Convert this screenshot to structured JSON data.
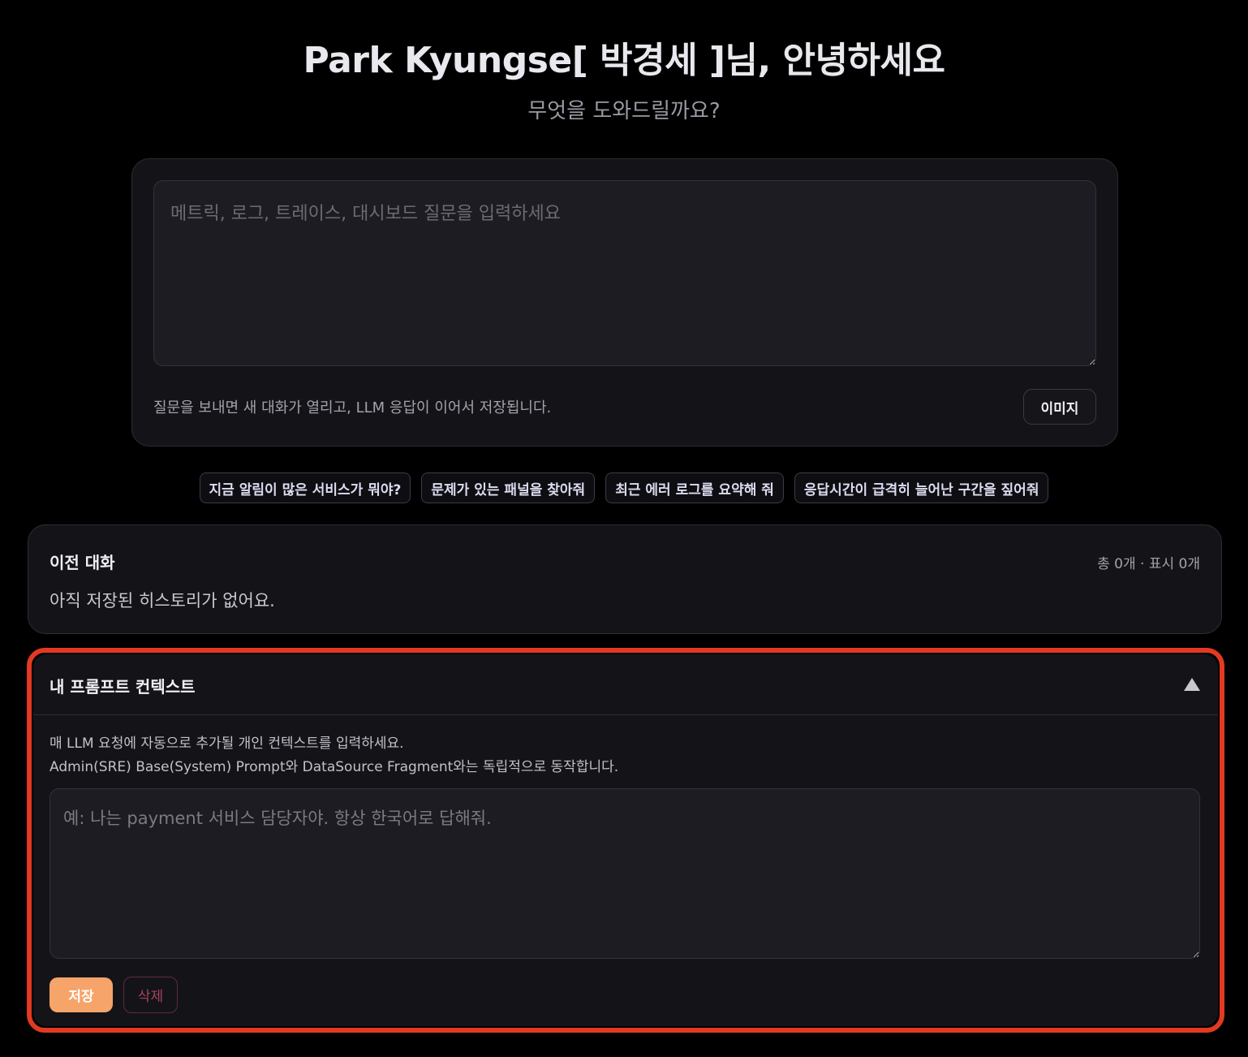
{
  "header": {
    "greeting": "Park Kyungse[ 박경세 ]님, 안녕하세요",
    "subtitle": "무엇을 도와드릴까요?"
  },
  "composer": {
    "placeholder": "메트릭, 로그, 트레이스, 대시보드 질문을 입력하세요",
    "value": "",
    "hint": "질문을 보내면 새 대화가 열리고, LLM 응답이 이어서 저장됩니다.",
    "image_button_label": "이미지"
  },
  "suggestions": [
    "지금 알림이 많은 서비스가 뭐야?",
    "문제가 있는 패널을 찾아줘",
    "최근 에러 로그를 요약해 줘",
    "응답시간이 급격히 늘어난 구간을 짚어줘"
  ],
  "history": {
    "title": "이전 대화",
    "count_text": "총 0개 · 표시 0개",
    "empty_text": "아직 저장된 히스토리가 없어요."
  },
  "prompt_context": {
    "title": "내 프롬프트 컨텍스트",
    "expanded": true,
    "collapse_icon": "triangle-up-icon",
    "description_line1": "매 LLM 요청에 자동으로 추가될 개인 컨텍스트를 입력하세요.",
    "description_line2": "Admin(SRE) Base(System) Prompt와 DataSource Fragment와는 독립적으로 동작합니다.",
    "placeholder": "예: 나는 payment 서비스 담당자야. 항상 한국어로 답해줘.",
    "value": "",
    "save_label": "저장",
    "delete_label": "삭제"
  },
  "colors": {
    "background": "#000000",
    "panel": "#141418",
    "accent": "#f6a46a",
    "danger": "#a4445e",
    "highlight": "#e23a22"
  }
}
